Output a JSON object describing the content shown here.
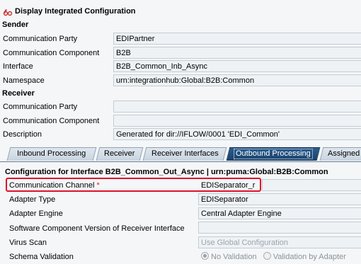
{
  "header": {
    "title": "Display Integrated Configuration",
    "icon": "glasses-icon"
  },
  "sender": {
    "heading": "Sender",
    "fields": [
      {
        "label": "Communication Party",
        "value": "EDIPartner"
      },
      {
        "label": "Communication Component",
        "value": "B2B"
      },
      {
        "label": "Interface",
        "value": "B2B_Common_Inb_Async"
      },
      {
        "label": "Namespace",
        "value": "urn:integrationhub:Global:B2B:Common"
      }
    ]
  },
  "receiver": {
    "heading": "Receiver",
    "fields": [
      {
        "label": "Communication Party",
        "value": ""
      },
      {
        "label": "Communication Component",
        "value": ""
      },
      {
        "label": "Description",
        "value": "Generated for dir://IFLOW/0001 'EDI_Common'"
      }
    ]
  },
  "tabs": [
    {
      "label": "Inbound Processing"
    },
    {
      "label": "Receiver"
    },
    {
      "label": "Receiver Interfaces"
    },
    {
      "label": "Outbound Processing",
      "active": true
    },
    {
      "label": "Assigned"
    }
  ],
  "config": {
    "title": "Configuration for Interface B2B_Common_Out_Async | urn:puma:Global:B2B:Common",
    "fields": [
      {
        "label": "Communication Channel",
        "required_marker": "*",
        "value": "EDISeparator_r"
      },
      {
        "label": "Adapter Type",
        "value": "EDISeparator"
      },
      {
        "label": "Adapter Engine",
        "value": "Central Adapter Engine"
      },
      {
        "label": "Software Component Version of Receiver Interface",
        "value": ""
      },
      {
        "label": "Virus Scan",
        "value": "Use Global Configuration"
      },
      {
        "label": "Schema Validation",
        "options": [
          "No Validation",
          "Validation by Adapter"
        ],
        "selected": "No Validation"
      }
    ]
  },
  "colors": {
    "active_tab": "#1f4a78",
    "highlight": "#e0112a",
    "required": "#d4201f"
  }
}
